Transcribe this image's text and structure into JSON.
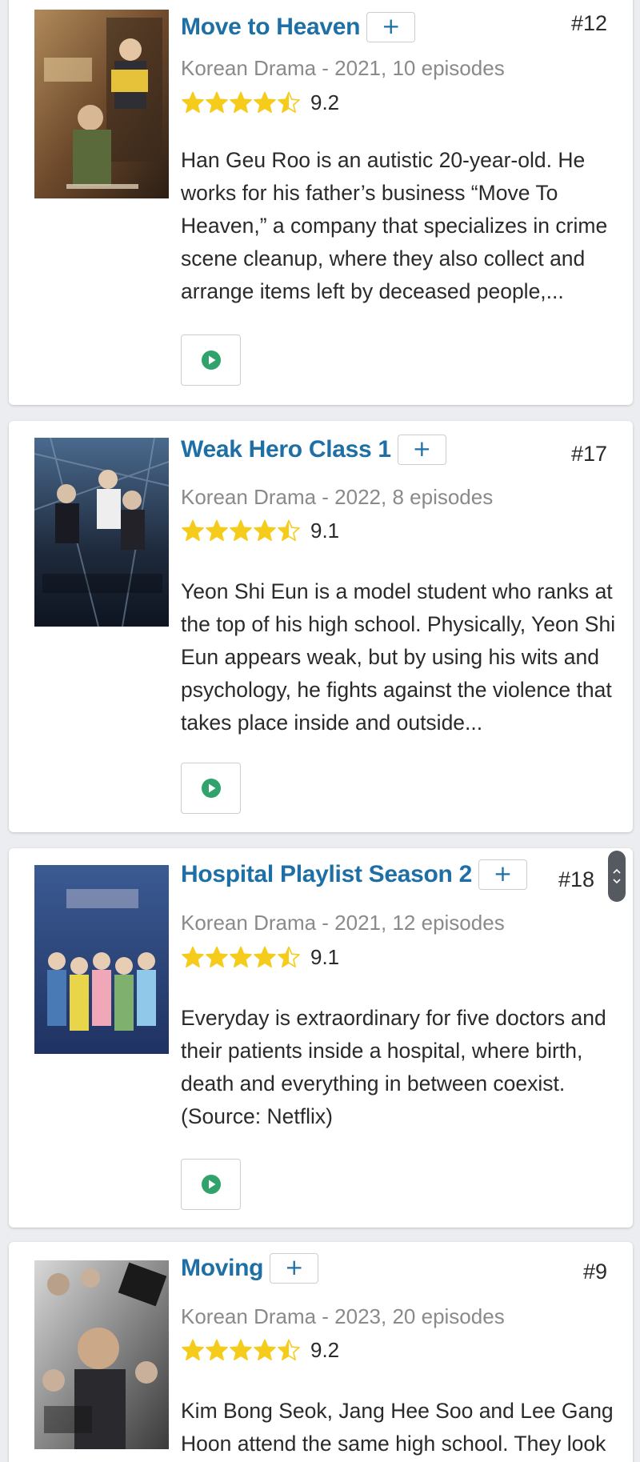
{
  "colors": {
    "title": "#1d6fa5",
    "star": "#f5cc1b",
    "play": "#2fa36b",
    "meta": "#8a8a8a"
  },
  "add_label": "+",
  "items": [
    {
      "title": "Move to Heaven",
      "rank": "#12",
      "meta": "Korean Drama - 2021, 10 episodes",
      "rating": 4.5,
      "score": "9.2",
      "synopsis": "Han Geu Roo is an autistic 20-year-old. He works for his father’s business “Move To Heaven,” a company that specializes in crime scene cleanup, where they also collect and arrange items left by deceased people,...",
      "poster_icon": "poster-image"
    },
    {
      "title": "Weak Hero Class 1",
      "rank": "#17",
      "meta": "Korean Drama - 2022, 8 episodes",
      "rating": 4.5,
      "score": "9.1",
      "synopsis": "Yeon Shi Eun is a model student who ranks at the top of his high school. Physically, Yeon Shi Eun appears weak, but by using his wits and psychology, he fights against the violence that takes place inside and outside...",
      "poster_icon": "poster-image"
    },
    {
      "title": "Hospital Playlist Season 2",
      "rank": "#18",
      "meta": "Korean Drama - 2021, 12 episodes",
      "rating": 4.5,
      "score": "9.1",
      "synopsis": "Everyday is extraordinary for five doctors and their patients inside a hospital, where birth, death and everything in between coexist. (Source: Netflix)",
      "poster_icon": "poster-image"
    },
    {
      "title": "Moving",
      "rank": "#9",
      "meta": "Korean Drama - 2023, 20 episodes",
      "rating": 4.5,
      "score": "9.2",
      "synopsis": "Kim Bong Seok, Jang Hee Soo and Lee Gang Hoon attend the same high school. They look",
      "poster_icon": "poster-image"
    }
  ]
}
